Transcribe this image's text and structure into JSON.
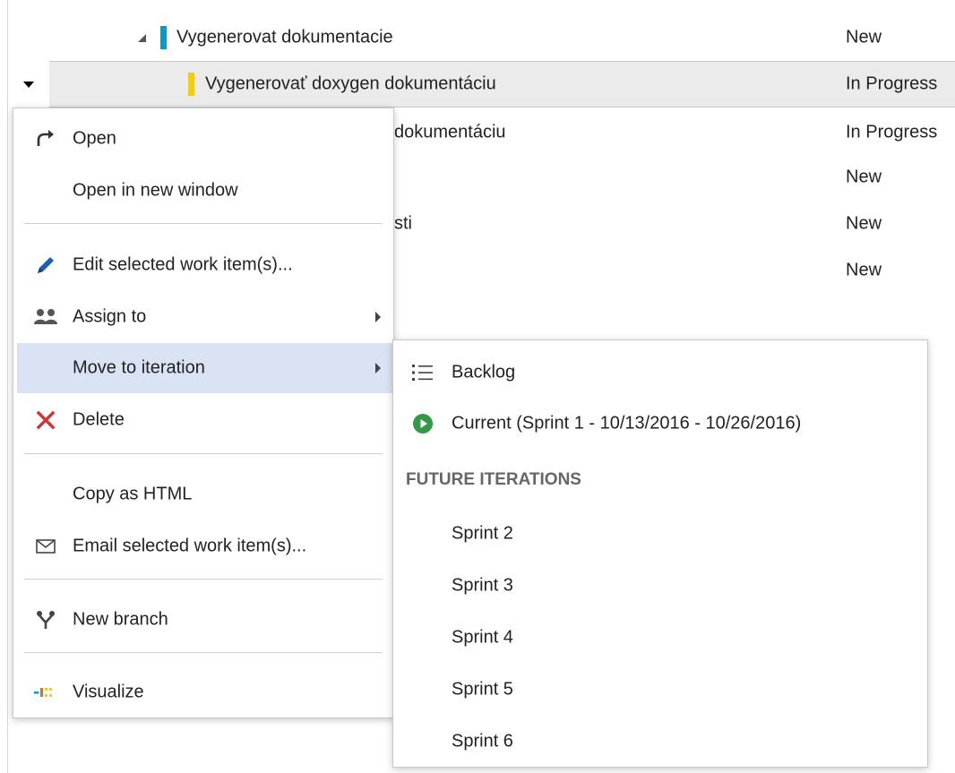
{
  "rows": [
    {
      "title": "Vygenerovat dokumentacie",
      "state": "New",
      "bar_color": "#009ccc"
    },
    {
      "title": "Vygenerovať doxygen dokumentáciu",
      "state": "In Progress",
      "bar_color": "#f2cb1d"
    },
    {
      "title": "dokumentáciu",
      "state": "In Progress"
    },
    {
      "title": "",
      "state": "New"
    },
    {
      "title": "sti",
      "state": "New"
    },
    {
      "title": "",
      "state": "New"
    }
  ],
  "context_menu": {
    "items": [
      {
        "label": "Open",
        "icon": "redo-arrow-icon"
      },
      {
        "label": "Open in new window"
      },
      {
        "label": "Edit selected work item(s)...",
        "icon": "pencil-icon"
      },
      {
        "label": "Assign to",
        "icon": "people-icon"
      },
      {
        "label": "Move to iteration"
      },
      {
        "label": "Delete",
        "icon": "delete-x-icon"
      },
      {
        "label": "Copy as HTML"
      },
      {
        "label": "Email selected work item(s)...",
        "icon": "envelope-icon"
      },
      {
        "label": "New branch",
        "icon": "branch-icon"
      },
      {
        "label": "Visualize",
        "icon": "visualize-icon"
      }
    ]
  },
  "iteration_submenu": {
    "backlog": {
      "label": "Backlog",
      "icon": "list-icon"
    },
    "current": {
      "label": "Current (Sprint 1 - 10/13/2016 - 10/26/2016)",
      "icon": "play-circle-icon"
    },
    "future_header": "FUTURE ITERATIONS",
    "future": [
      {
        "label": "Sprint 2"
      },
      {
        "label": "Sprint 3"
      },
      {
        "label": "Sprint 4"
      },
      {
        "label": "Sprint 5"
      },
      {
        "label": "Sprint 6"
      }
    ]
  },
  "colors": {
    "accent_blue": "#009ccc",
    "accent_yellow": "#f2cb1d",
    "hover": "#dae3f3",
    "delete_red": "#d13438",
    "pencil_blue": "#1e5fb4",
    "current_green": "#339947"
  }
}
